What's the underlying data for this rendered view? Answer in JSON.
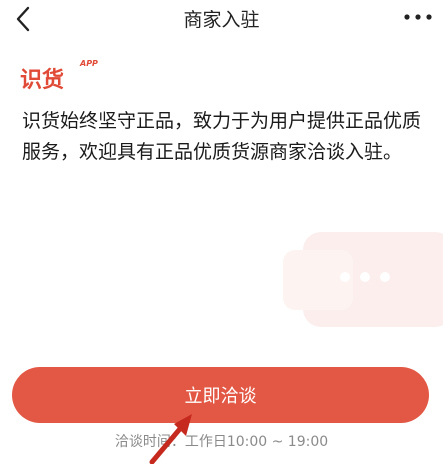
{
  "header": {
    "title": "商家入驻",
    "back_icon": "chevron-left-icon",
    "more_icon": "more-dots-icon"
  },
  "brand": {
    "logo_text": "识货",
    "logo_sup": "APP",
    "color": "#e04a37"
  },
  "intro": {
    "text": "识货始终坚守正品，致力于为用户提供正品优质服务，欢迎具有正品优质货源商家洽谈入驻。"
  },
  "cta": {
    "label": "立即洽谈",
    "color": "#e35845"
  },
  "hours": {
    "text": "洽谈时间：工作日10:00 ~ 19:00"
  }
}
